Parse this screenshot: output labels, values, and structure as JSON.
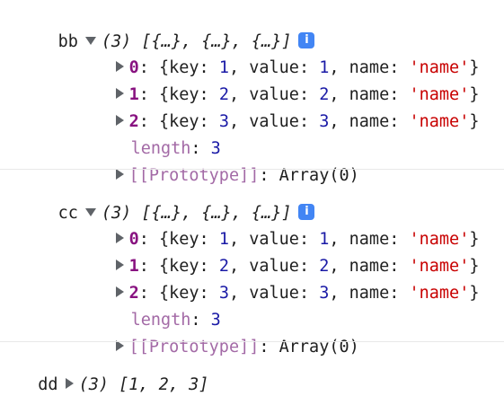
{
  "entries": [
    {
      "name": "bb",
      "summary_count": "(3)",
      "summary_body": "[{…}, {…}, {…}]",
      "info_icon": "i",
      "items": [
        {
          "index": "0",
          "key": "1",
          "value": "1",
          "name": "'name'"
        },
        {
          "index": "1",
          "key": "2",
          "value": "2",
          "name": "'name'"
        },
        {
          "index": "2",
          "key": "3",
          "value": "3",
          "name": "'name'"
        }
      ],
      "length_label": "length",
      "length_value": "3",
      "prototype_label": "[[Prototype]]",
      "prototype_value": "Array(0)"
    },
    {
      "name": "cc",
      "summary_count": "(3)",
      "summary_body": "[{…}, {…}, {…}]",
      "info_icon": "i",
      "items": [
        {
          "index": "0",
          "key": "1",
          "value": "1",
          "name": "'name'"
        },
        {
          "index": "1",
          "key": "2",
          "value": "2",
          "name": "'name'"
        },
        {
          "index": "2",
          "key": "3",
          "value": "3",
          "name": "'name'"
        }
      ],
      "length_label": "length",
      "length_value": "3",
      "prototype_label": "[[Prototype]]",
      "prototype_value": "Array(0)"
    }
  ],
  "dd": {
    "name": "dd",
    "summary_count": "(3)",
    "summary_body": "[1, 2, 3]"
  },
  "syntax": {
    "key_label": "key",
    "value_label": "value",
    "name_label": "name"
  }
}
